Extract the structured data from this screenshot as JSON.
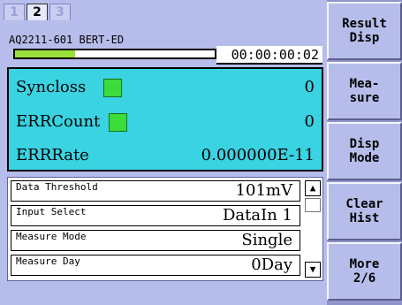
{
  "tabs": [
    {
      "label": "1",
      "active": false
    },
    {
      "label": "2",
      "active": true
    },
    {
      "label": "3",
      "active": false
    }
  ],
  "device_title": "AQ2211-601 BERT-ED",
  "progress": {
    "fraction": 0.3
  },
  "timer": "00:00:00:02",
  "measurements": [
    {
      "label": "Syncloss",
      "value": "0",
      "indicator_color": "#3bdc3b"
    },
    {
      "label": "ERRCount",
      "value": "0",
      "indicator_color": "#3bdc3b"
    },
    {
      "label": "ERRRate",
      "value": "0.000000E-11"
    }
  ],
  "settings": [
    {
      "label": "Data Threshold",
      "value": "101mV"
    },
    {
      "label": "Input Select",
      "value": "DataIn 1"
    },
    {
      "label": "Measure Mode",
      "value": "Single"
    },
    {
      "label": "Measure Day",
      "value": "0Day"
    }
  ],
  "scrollbar": {
    "up_icon": "up-arrow-icon",
    "down_icon": "down-arrow-icon"
  },
  "softkeys": [
    {
      "label": "Result\nDisp"
    },
    {
      "label": "Mea-\nsure"
    },
    {
      "label": "Disp\nMode"
    },
    {
      "label": "Clear\nHist"
    },
    {
      "label": "More\n2/6"
    }
  ]
}
